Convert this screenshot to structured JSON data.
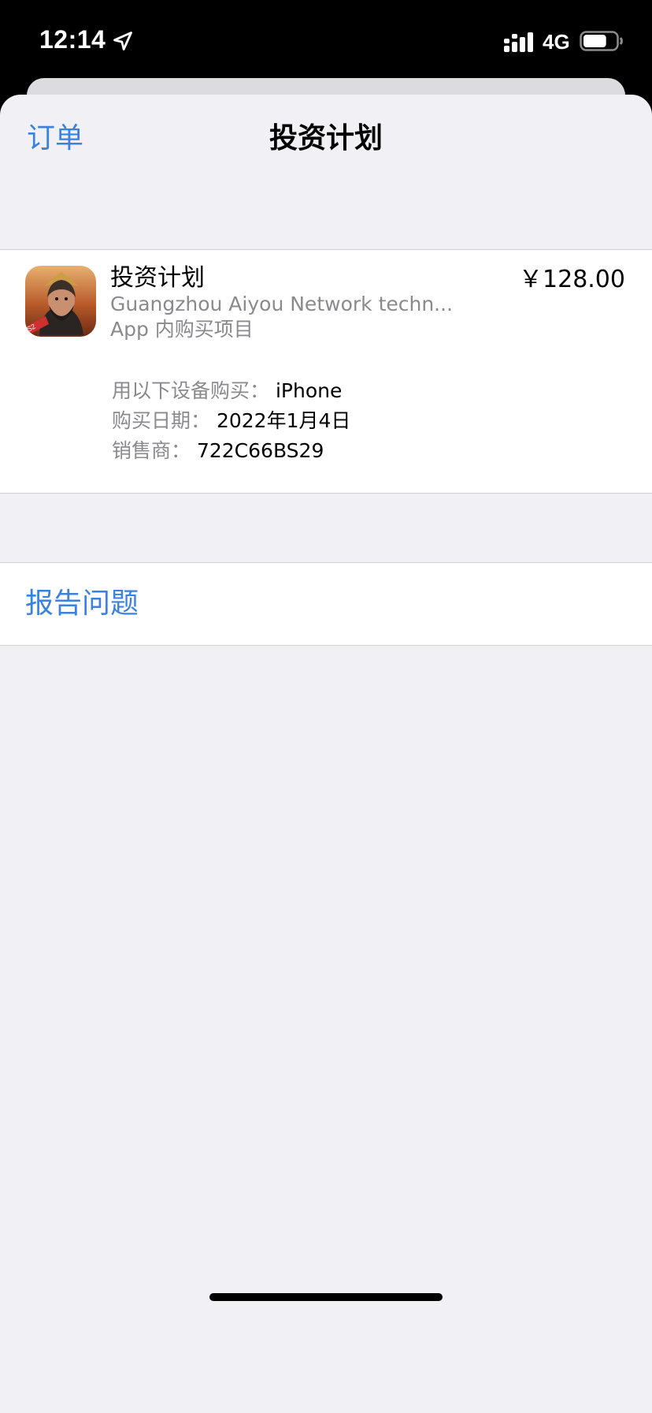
{
  "status_bar": {
    "time": "12:14",
    "network": "4G",
    "battery_level": 0.7,
    "icons": [
      "location-arrow-icon",
      "signal-icon",
      "battery-icon"
    ]
  },
  "nav": {
    "back_label": "订单",
    "title": "投资计划"
  },
  "purchase": {
    "app_icon": "app-icon-game-warrior",
    "app_name": "投资计划",
    "developer": "Guangzhou Aiyou Network techn...",
    "kind": "App 内购买项目",
    "price": "￥128.00",
    "details": [
      {
        "label": "用以下设备购买：",
        "value": "iPhone"
      },
      {
        "label": "购买日期：",
        "value": "2022年1月4日"
      },
      {
        "label": "销售商：",
        "value": "722C66BS29"
      }
    ]
  },
  "actions": {
    "report_label": "报告问题"
  },
  "colors": {
    "accent": "#3a82de",
    "background": "#f0f0f5",
    "secondary_text": "#8a8a8e"
  }
}
